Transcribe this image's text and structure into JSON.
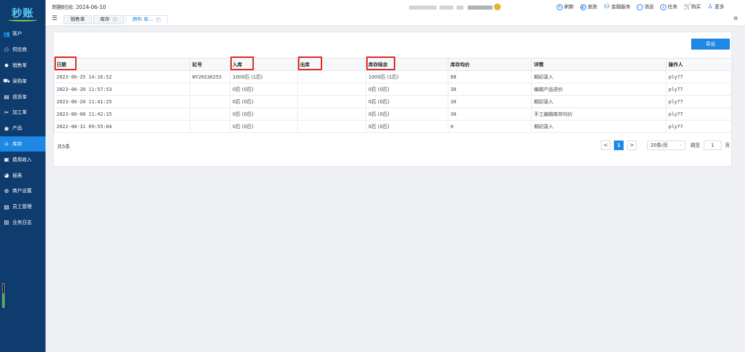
{
  "app": {
    "logo_text": "秒账"
  },
  "sidebar": {
    "items": [
      {
        "label": "客户",
        "icon": "customers-icon",
        "glyph": "👥"
      },
      {
        "label": "供应商",
        "icon": "supplier-icon",
        "glyph": "⚇"
      },
      {
        "label": "销售单",
        "icon": "tag-icon",
        "glyph": "◆"
      },
      {
        "label": "采购单",
        "icon": "cart-icon",
        "glyph": "⛟"
      },
      {
        "label": "退货单",
        "icon": "return-icon",
        "glyph": "▤"
      },
      {
        "label": "加工单",
        "icon": "scissors-icon",
        "glyph": "✂"
      },
      {
        "label": "产品",
        "icon": "product-icon",
        "glyph": "◉"
      },
      {
        "label": "库存",
        "icon": "warehouse-icon",
        "glyph": "⌂",
        "active": true
      },
      {
        "label": "费用收入",
        "icon": "finance-icon",
        "glyph": "▣"
      },
      {
        "label": "报表",
        "icon": "pie-chart-icon",
        "glyph": "◕"
      },
      {
        "label": "商户设置",
        "icon": "gear-icon",
        "glyph": "⚙"
      },
      {
        "label": "员工管理",
        "icon": "staff-icon",
        "glyph": "▨"
      },
      {
        "label": "业务日志",
        "icon": "log-icon",
        "glyph": "▥"
      }
    ],
    "indicator_level": 0.6
  },
  "topbar": {
    "expire_text": "到期时间: 2024-06-10",
    "tabs": [
      {
        "label": "销售单",
        "active": false,
        "closable": false
      },
      {
        "label": "库存",
        "active": false,
        "closable": true
      },
      {
        "label": "麻布 库...",
        "active": true,
        "closable": true
      }
    ],
    "tools": [
      {
        "label": "刷新",
        "icon": "refresh-icon",
        "glyph": "↻"
      },
      {
        "label": "皮肤",
        "icon": "skin-icon",
        "glyph": "◐"
      },
      {
        "label": "金融服务",
        "icon": "finance-service-icon",
        "glyph": "⛁"
      },
      {
        "label": "消息",
        "icon": "message-icon",
        "glyph": "⋯"
      },
      {
        "label": "任务",
        "icon": "task-icon",
        "glyph": "↓"
      },
      {
        "label": "购买",
        "icon": "cart-icon",
        "glyph": "🛒"
      },
      {
        "label": "更多",
        "icon": "user-icon",
        "glyph": "♙"
      }
    ]
  },
  "main": {
    "export_label": "导出",
    "columns": [
      "日期",
      "缸号",
      "入库",
      "出库",
      "库存结余",
      "库存均价",
      "详情",
      "操作人"
    ],
    "highlighted_columns": [
      "日期",
      "入库",
      "出库",
      "库存结余"
    ],
    "rows": [
      [
        "2023-06-25 14:16:52",
        "WY20236253",
        "1000匹 (1匹)",
        "",
        "1000匹 (1匹)",
        "88",
        "期初录入",
        "ply77"
      ],
      [
        "2023-06-20 11:57:53",
        "",
        "0匹 (0匹)",
        "",
        "0匹 (0匹)",
        "30",
        "编辑产品进价",
        "ply77"
      ],
      [
        "2023-06-20 11:41:25",
        "",
        "0匹 (0匹)",
        "",
        "0匹 (0匹)",
        "30",
        "期初录入",
        "ply77"
      ],
      [
        "2023-06-08 11:42:15",
        "",
        "0匹 (0匹)",
        "",
        "0匹 (0匹)",
        "30",
        "手工编辑库存均价",
        "ply77"
      ],
      [
        "2022-08-31 09:55:04",
        "",
        "0匹 (0匹)",
        "",
        "0匹 (0匹)",
        "0",
        "期初录入",
        "ply77"
      ]
    ],
    "footer": {
      "total_text": "共5条",
      "prev": "<",
      "next": ">",
      "current_page": "1",
      "page_size": "20条/页",
      "jump_label": "跳至",
      "jump_value": "1",
      "page_unit": "页"
    }
  }
}
